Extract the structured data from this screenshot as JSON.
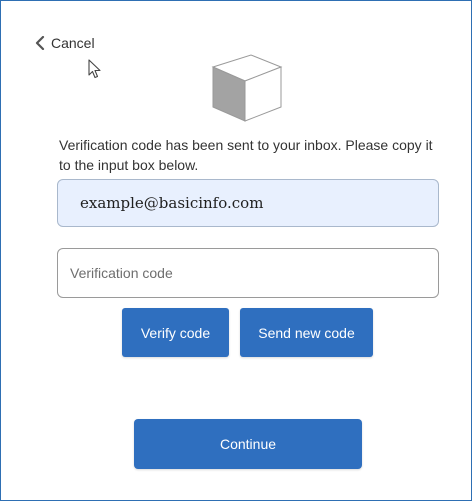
{
  "header": {
    "cancel_label": "Cancel"
  },
  "message": {
    "text": "Verification code has been sent to your inbox. Please copy it to the input box below."
  },
  "email": {
    "value": "example@basicinfo.com"
  },
  "verification": {
    "placeholder": "Verification code",
    "value": ""
  },
  "buttons": {
    "verify_label": "Verify code",
    "send_new_label": "Send new code",
    "continue_label": "Continue"
  },
  "colors": {
    "primary_button": "#2f6fbf",
    "email_field_bg": "#e8f0fe",
    "frame_border": "#2e6fb3"
  },
  "icons": {
    "back": "chevron-left-icon",
    "logo": "cube-icon",
    "pointer": "mouse-cursor-icon"
  }
}
